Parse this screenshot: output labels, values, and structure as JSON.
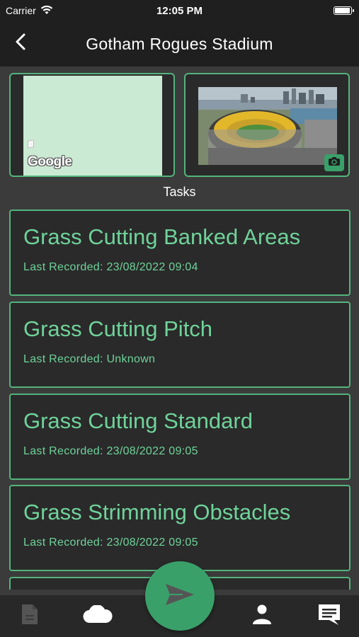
{
  "status_bar": {
    "carrier": "Carrier",
    "time": "12:05 PM",
    "battery_level": 1.0
  },
  "nav": {
    "title": "Gotham Rogues Stadium",
    "back_icon": "chevron-left-icon"
  },
  "media": {
    "map_attribution": "Google",
    "camera_icon": "camera-icon"
  },
  "tasks_heading": "Tasks",
  "tasks": [
    {
      "name": "Grass Cutting Banked Areas",
      "last_recorded": "Last Recorded: 23/08/2022 09:04"
    },
    {
      "name": "Grass Cutting Pitch",
      "last_recorded": "Last Recorded: Unknown"
    },
    {
      "name": "Grass Cutting Standard",
      "last_recorded": "Last Recorded: 23/08/2022 09:05"
    },
    {
      "name": "Grass Strimming Obstacles",
      "last_recorded": "Last Recorded: 23/08/2022 09:05"
    },
    {
      "name": "",
      "last_recorded": ""
    }
  ],
  "tab_bar": {
    "items": [
      {
        "icon": "document-icon",
        "active": false
      },
      {
        "icon": "cloud-icon",
        "active": true
      },
      {
        "icon": "send-icon",
        "active": false
      },
      {
        "icon": "person-icon",
        "active": true
      },
      {
        "icon": "chat-icon",
        "active": true
      }
    ]
  },
  "colors": {
    "accent": "#54b47c",
    "task_text": "#6fd39a",
    "fab": "#3aa06a",
    "background": "#3b3b3b",
    "header": "#1f1f1f"
  }
}
